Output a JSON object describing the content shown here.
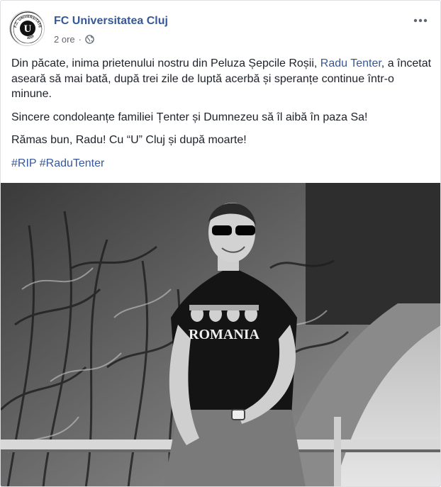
{
  "post": {
    "page_name": "FC Universitatea Cluj",
    "time": "2 ore",
    "privacy_icon": "globe-icon",
    "more_icon": "more-options-icon",
    "avatar": {
      "ring_text_top": "F.C. UNIVERSITATEA CLUJ",
      "ring_text_bottom": "1919",
      "letter": "U"
    },
    "paragraph1": {
      "before_link": "Din păcate, inima prietenului nostru din Peluza Șepcile Roșii, ",
      "link": "Radu Tenter",
      "after_link": ", a încetat aseară să mai bată, după trei zile de luptă acerbă și speranțe continue într-o minune."
    },
    "paragraph2": "Sincere condoleanțe familiei Țenter și Dumnezeu să îl aibă în paza Sa!",
    "paragraph3": "Rămas bun, Radu! Cu “U” Cluj și după moarte!",
    "hashtags": [
      "#RIP",
      "#RaduTenter"
    ],
    "photo": {
      "shirt_text": "ROMANIA"
    }
  },
  "colors": {
    "link": "#365899",
    "text": "#1d2129",
    "meta": "#616770"
  }
}
